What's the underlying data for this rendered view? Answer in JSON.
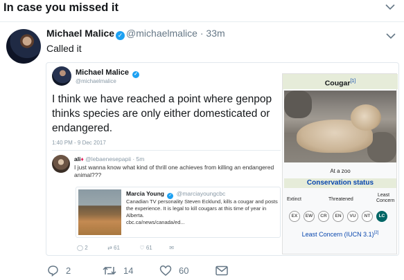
{
  "banner": {
    "title": "In case you missed it"
  },
  "tweet": {
    "name": "Michael Malice",
    "handle": "@michaelmalice",
    "separator": "·",
    "time": "33m",
    "text": "Called it",
    "actions": {
      "reply_count": "2",
      "retweet_count": "14",
      "like_count": "60"
    }
  },
  "embedded": {
    "name": "Michael Malice",
    "handle": "@michaelmalice",
    "text": "I think we have reached a point where genpop thinks species are only either domesticated or endangered.",
    "date": "1:40 PM - 9 Dec 2017",
    "reply": {
      "name": "ali",
      "handle": "@lebaenesepapii · 5m",
      "text": "I just wanna know what kind of thrill one achieves from killing an endangered animal???"
    },
    "quote": {
      "name": "Marcia Young",
      "handle": "@marciayoungcbc",
      "text": "Canadian TV personality Steven Ecklund, kills a cougar and posts the experience. It is legal to kill cougars at this time of year in Alberta.",
      "link": "cbc.ca/news/canada/ed..."
    },
    "mini_actions": {
      "reply": "2",
      "retweet": "61",
      "like": "61"
    }
  },
  "wiki": {
    "title": "Cougar",
    "title_ref": "[1]",
    "caption": "At a zoo",
    "conservation_heading": "Conservation status",
    "labels": {
      "extinct": "Extinct",
      "threatened": "Threatened",
      "least": "Least",
      "concern": "Concern"
    },
    "statuses": [
      "EX",
      "EW",
      "CR",
      "EN",
      "VU",
      "NT",
      "LC"
    ],
    "active_status": "LC",
    "status_text": "Least Concern (IUCN 3.1)",
    "status_ref": "[2]"
  }
}
